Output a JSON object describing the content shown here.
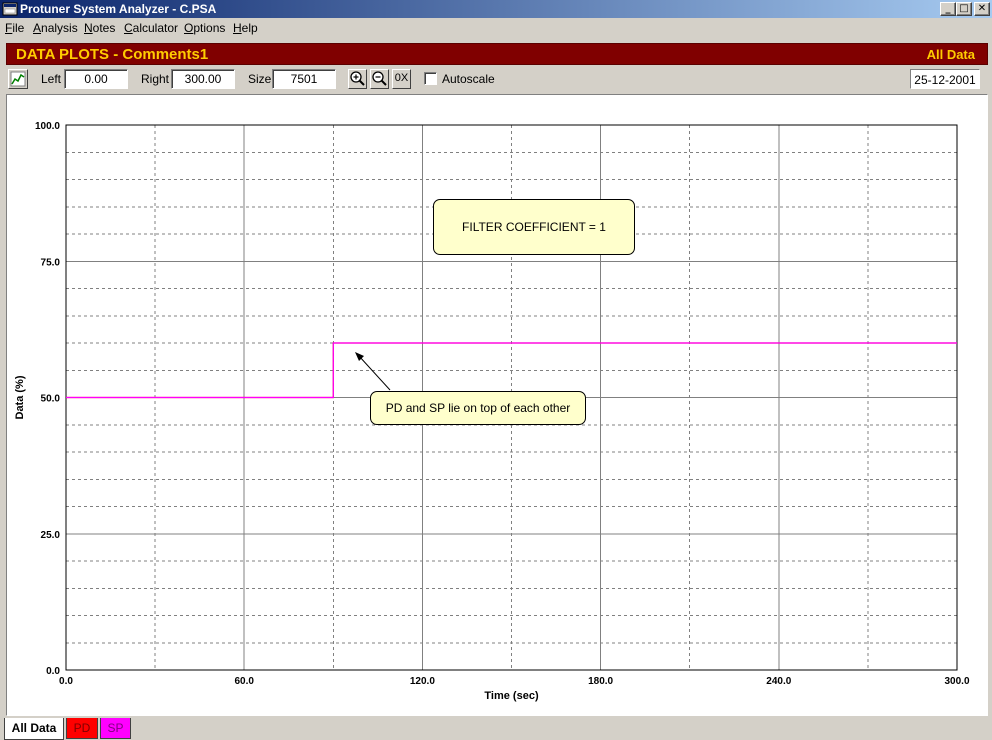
{
  "window": {
    "title": "Protuner System Analyzer - C.PSA",
    "controls": [
      "_",
      "□",
      "✕"
    ]
  },
  "menu": [
    {
      "label": "File",
      "u": "F",
      "rest": "ile"
    },
    {
      "label": "Analysis",
      "u": "A",
      "rest": "nalysis"
    },
    {
      "label": "Notes",
      "u": "N",
      "rest": "otes"
    },
    {
      "label": "Calculator",
      "u": "C",
      "rest": "alculator"
    },
    {
      "label": "Options",
      "u": "O",
      "rest": "ptions"
    },
    {
      "label": "Help",
      "u": "H",
      "rest": "elp"
    }
  ],
  "header": {
    "title": "DATA PLOTS - Comments1",
    "view": "All Data",
    "bg_color": "#800000",
    "text_color": "#ffcc00"
  },
  "toolbar": {
    "chart_icon": "line-chart-icon",
    "left_label": "Left",
    "left_value": "0.00",
    "right_label": "Right",
    "right_value": "300.00",
    "size_label": "Size",
    "size_value": "7501",
    "zoom_in_icon": "zoom-in-icon",
    "zoom_out_icon": "zoom-out-icon",
    "zoom_reset_label": "0X",
    "autoscale_label": "Autoscale",
    "autoscale_checked": false,
    "date": "25-12-2001"
  },
  "notes": {
    "filter": "FILTER COEFFICIENT = 1",
    "overlap": "PD and SP lie on top of each other"
  },
  "tabs": [
    {
      "label": "All Data",
      "color": "#d4d0c8",
      "active": true
    },
    {
      "label": "PD",
      "color": "#ff0000",
      "active": false
    },
    {
      "label": "SP",
      "color": "#ff00ff",
      "active": false
    }
  ],
  "chart_data": {
    "type": "line",
    "xlabel": "Time (sec)",
    "ylabel": "Data (%)",
    "xlim": [
      0,
      300
    ],
    "ylim": [
      0,
      100
    ],
    "x_ticks": [
      "0.0",
      "60.0",
      "120.0",
      "180.0",
      "240.0",
      "300.0"
    ],
    "y_ticks": [
      "0.0",
      "25.0",
      "50.0",
      "75.0",
      "100.0"
    ],
    "grid": true,
    "series": [
      {
        "name": "PD",
        "color": "#ff0000",
        "x": [
          0,
          90,
          90,
          300
        ],
        "y": [
          50,
          50,
          60,
          60
        ]
      },
      {
        "name": "SP",
        "color": "#ff00ff",
        "x": [
          0,
          90,
          90,
          300
        ],
        "y": [
          50,
          50,
          60,
          60
        ]
      }
    ]
  }
}
